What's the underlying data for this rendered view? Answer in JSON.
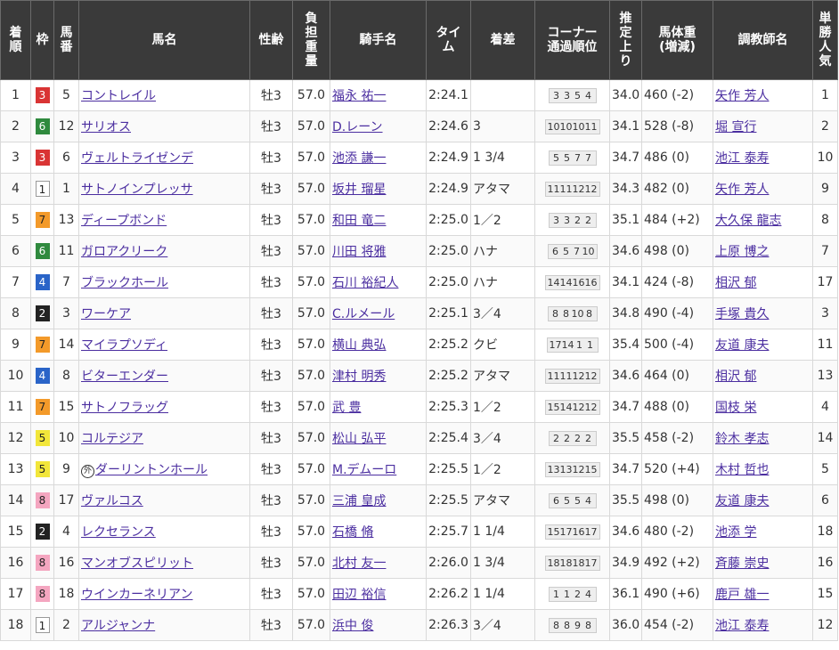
{
  "headers": {
    "chakujun": [
      "着",
      "順"
    ],
    "waku": "枠",
    "umaban": [
      "馬",
      "番"
    ],
    "bamei": "馬名",
    "seirei": "性齢",
    "kinryo": [
      "負",
      "担",
      "重",
      "量"
    ],
    "kishu": "騎手名",
    "time": [
      "タイ",
      "ム"
    ],
    "chakusa": "着差",
    "corner": [
      "コーナー",
      "通過順位"
    ],
    "agari": [
      "推",
      "定",
      "上",
      "り"
    ],
    "bataiju": [
      "馬体重",
      "(増減)"
    ],
    "chokyoshi": "調教師名",
    "ninki": [
      "単",
      "勝",
      "人",
      "気"
    ]
  },
  "rows": [
    {
      "pos": "1",
      "waku": "3",
      "umaban": "5",
      "name": "コントレイル",
      "mark": "",
      "sex_age": "牡3",
      "weight": "57.0",
      "jockey": "福永 祐一",
      "time": "2:24.1",
      "margin": "",
      "corner": [
        "3",
        "3",
        "5",
        "4"
      ],
      "agari": "34.0",
      "body": "460 (-2)",
      "trainer": "矢作 芳人",
      "pop": "1"
    },
    {
      "pos": "2",
      "waku": "6",
      "umaban": "12",
      "name": "サリオス",
      "mark": "",
      "sex_age": "牡3",
      "weight": "57.0",
      "jockey": "D.レーン",
      "time": "2:24.6",
      "margin": "3",
      "corner": [
        "10",
        "10",
        "10",
        "11"
      ],
      "agari": "34.1",
      "body": "528 (-8)",
      "trainer": "堀 宣行",
      "pop": "2"
    },
    {
      "pos": "3",
      "waku": "3",
      "umaban": "6",
      "name": "ヴェルトライゼンデ",
      "mark": "",
      "sex_age": "牡3",
      "weight": "57.0",
      "jockey": "池添 謙一",
      "time": "2:24.9",
      "margin": "1 3/4",
      "corner": [
        "5",
        "5",
        "7",
        "7"
      ],
      "agari": "34.7",
      "body": "486 (0)",
      "trainer": "池江 泰寿",
      "pop": "10"
    },
    {
      "pos": "4",
      "waku": "1",
      "umaban": "1",
      "name": "サトノインプレッサ",
      "mark": "",
      "sex_age": "牡3",
      "weight": "57.0",
      "jockey": "坂井 瑠星",
      "time": "2:24.9",
      "margin": "アタマ",
      "corner": [
        "11",
        "11",
        "12",
        "12"
      ],
      "agari": "34.3",
      "body": "482 (0)",
      "trainer": "矢作 芳人",
      "pop": "9"
    },
    {
      "pos": "5",
      "waku": "7",
      "umaban": "13",
      "name": "ディープボンド",
      "mark": "",
      "sex_age": "牡3",
      "weight": "57.0",
      "jockey": "和田 竜二",
      "time": "2:25.0",
      "margin": "1／2",
      "corner": [
        "3",
        "3",
        "2",
        "2"
      ],
      "agari": "35.1",
      "body": "484 (+2)",
      "trainer": "大久保 龍志",
      "pop": "8"
    },
    {
      "pos": "6",
      "waku": "6",
      "umaban": "11",
      "name": "ガロアクリーク",
      "mark": "",
      "sex_age": "牡3",
      "weight": "57.0",
      "jockey": "川田 将雅",
      "time": "2:25.0",
      "margin": "ハナ",
      "corner": [
        "6",
        "5",
        "7",
        "10"
      ],
      "agari": "34.6",
      "body": "498 (0)",
      "trainer": "上原 博之",
      "pop": "7"
    },
    {
      "pos": "7",
      "waku": "4",
      "umaban": "7",
      "name": "ブラックホール",
      "mark": "",
      "sex_age": "牡3",
      "weight": "57.0",
      "jockey": "石川 裕紀人",
      "time": "2:25.0",
      "margin": "ハナ",
      "corner": [
        "14",
        "14",
        "16",
        "16"
      ],
      "agari": "34.1",
      "body": "424 (-8)",
      "trainer": "相沢 郁",
      "pop": "17"
    },
    {
      "pos": "8",
      "waku": "2",
      "umaban": "3",
      "name": "ワーケア",
      "mark": "",
      "sex_age": "牡3",
      "weight": "57.0",
      "jockey": "C.ルメール",
      "time": "2:25.1",
      "margin": "3／4",
      "corner": [
        "8",
        "8",
        "10",
        "8"
      ],
      "agari": "34.8",
      "body": "490 (-4)",
      "trainer": "手塚 貴久",
      "pop": "3"
    },
    {
      "pos": "9",
      "waku": "7",
      "umaban": "14",
      "name": "マイラプソディ",
      "mark": "",
      "sex_age": "牡3",
      "weight": "57.0",
      "jockey": "横山 典弘",
      "time": "2:25.2",
      "margin": "クビ",
      "corner": [
        "17",
        "14",
        "1",
        "1"
      ],
      "agari": "35.4",
      "body": "500 (-4)",
      "trainer": "友道 康夫",
      "pop": "11"
    },
    {
      "pos": "10",
      "waku": "4",
      "umaban": "8",
      "name": "ビターエンダー",
      "mark": "",
      "sex_age": "牡3",
      "weight": "57.0",
      "jockey": "津村 明秀",
      "time": "2:25.2",
      "margin": "アタマ",
      "corner": [
        "11",
        "11",
        "12",
        "12"
      ],
      "agari": "34.6",
      "body": "464 (0)",
      "trainer": "相沢 郁",
      "pop": "13"
    },
    {
      "pos": "11",
      "waku": "7",
      "umaban": "15",
      "name": "サトノフラッグ",
      "mark": "",
      "sex_age": "牡3",
      "weight": "57.0",
      "jockey": "武 豊",
      "time": "2:25.3",
      "margin": "1／2",
      "corner": [
        "15",
        "14",
        "12",
        "12"
      ],
      "agari": "34.7",
      "body": "488 (0)",
      "trainer": "国枝 栄",
      "pop": "4"
    },
    {
      "pos": "12",
      "waku": "5",
      "umaban": "10",
      "name": "コルテジア",
      "mark": "",
      "sex_age": "牡3",
      "weight": "57.0",
      "jockey": "松山 弘平",
      "time": "2:25.4",
      "margin": "3／4",
      "corner": [
        "2",
        "2",
        "2",
        "2"
      ],
      "agari": "35.5",
      "body": "458 (-2)",
      "trainer": "鈴木 孝志",
      "pop": "14"
    },
    {
      "pos": "13",
      "waku": "5",
      "umaban": "9",
      "name": "ダーリントンホール",
      "mark": "外",
      "sex_age": "牡3",
      "weight": "57.0",
      "jockey": "M.デムーロ",
      "time": "2:25.5",
      "margin": "1／2",
      "corner": [
        "13",
        "13",
        "12",
        "15"
      ],
      "agari": "34.7",
      "body": "520 (+4)",
      "trainer": "木村 哲也",
      "pop": "5"
    },
    {
      "pos": "14",
      "waku": "8",
      "umaban": "17",
      "name": "ヴァルコス",
      "mark": "",
      "sex_age": "牡3",
      "weight": "57.0",
      "jockey": "三浦 皇成",
      "time": "2:25.5",
      "margin": "アタマ",
      "corner": [
        "6",
        "5",
        "5",
        "4"
      ],
      "agari": "35.5",
      "body": "498 (0)",
      "trainer": "友道 康夫",
      "pop": "6"
    },
    {
      "pos": "15",
      "waku": "2",
      "umaban": "4",
      "name": "レクセランス",
      "mark": "",
      "sex_age": "牡3",
      "weight": "57.0",
      "jockey": "石橋 脩",
      "time": "2:25.7",
      "margin": "1 1/4",
      "corner": [
        "15",
        "17",
        "16",
        "17"
      ],
      "agari": "34.6",
      "body": "480 (-2)",
      "trainer": "池添 学",
      "pop": "18"
    },
    {
      "pos": "16",
      "waku": "8",
      "umaban": "16",
      "name": "マンオブスピリット",
      "mark": "",
      "sex_age": "牡3",
      "weight": "57.0",
      "jockey": "北村 友一",
      "time": "2:26.0",
      "margin": "1 3/4",
      "corner": [
        "18",
        "18",
        "18",
        "17"
      ],
      "agari": "34.9",
      "body": "492 (+2)",
      "trainer": "斉藤 崇史",
      "pop": "16"
    },
    {
      "pos": "17",
      "waku": "8",
      "umaban": "18",
      "name": "ウインカーネリアン",
      "mark": "",
      "sex_age": "牡3",
      "weight": "57.0",
      "jockey": "田辺 裕信",
      "time": "2:26.2",
      "margin": "1 1/4",
      "corner": [
        "1",
        "1",
        "2",
        "4"
      ],
      "agari": "36.1",
      "body": "490 (+6)",
      "trainer": "鹿戸 雄一",
      "pop": "15"
    },
    {
      "pos": "18",
      "waku": "1",
      "umaban": "2",
      "name": "アルジャンナ",
      "mark": "",
      "sex_age": "牡3",
      "weight": "57.0",
      "jockey": "浜中 俊",
      "time": "2:26.3",
      "margin": "3／4",
      "corner": [
        "8",
        "8",
        "9",
        "8"
      ],
      "agari": "36.0",
      "body": "454 (-2)",
      "trainer": "池江 泰寿",
      "pop": "12"
    }
  ]
}
